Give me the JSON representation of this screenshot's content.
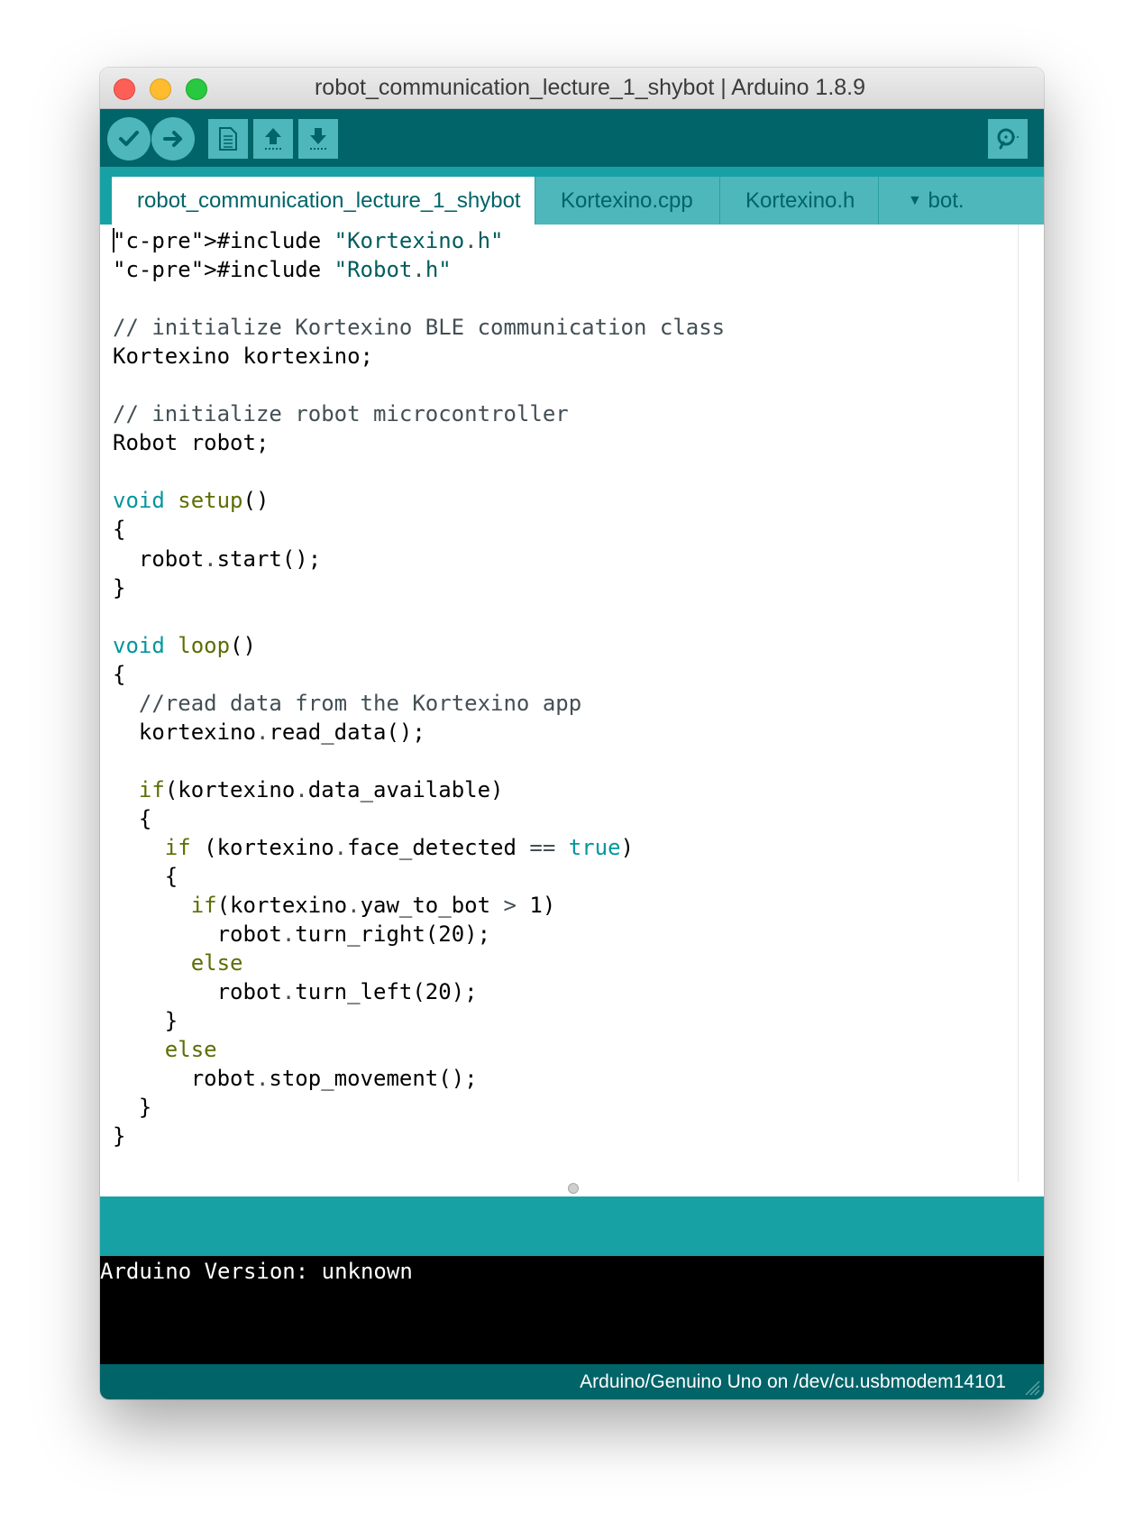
{
  "window": {
    "title": "robot_communication_lecture_1_shybot | Arduino 1.8.9"
  },
  "toolbar": {
    "verify_icon": "checkmark-icon",
    "upload_icon": "arrow-right-icon",
    "new_icon": "document-icon",
    "open_icon": "arrow-up-icon",
    "save_icon": "arrow-down-icon",
    "serial_monitor_icon": "magnifier-icon"
  },
  "tabs": [
    {
      "label": "robot_communication_lecture_1_shybot",
      "active": true
    },
    {
      "label": "Kortexino.cpp",
      "active": false
    },
    {
      "label": "Kortexino.h",
      "active": false
    },
    {
      "label": "bot.",
      "active": false
    }
  ],
  "editor": {
    "lines": [
      "#include \"Kortexino.h\"",
      "#include \"Robot.h\"",
      "",
      "// initialize Kortexino BLE communication class",
      "Kortexino kortexino;",
      "",
      "// initialize robot microcontroller",
      "Robot robot;",
      "",
      "void setup()",
      "{",
      "  robot.start();",
      "}",
      "",
      "void loop()",
      "{",
      "  //read data from the Kortexino app",
      "  kortexino.read_data();",
      "",
      "  if(kortexino.data_available)",
      "  {",
      "    if (kortexino.face_detected == true)",
      "    {",
      "      if(kortexino.yaw_to_bot > 1)",
      "        robot.turn_right(20);",
      "      else",
      "        robot.turn_left(20);",
      "    }",
      "    else",
      "      robot.stop_movement();",
      "  }",
      "}"
    ]
  },
  "console": {
    "text": "Arduino Version: unknown"
  },
  "status": {
    "board": "Arduino/Genuino Uno on /dev/cu.usbmodem14101"
  },
  "colors": {
    "toolbar": "#006468",
    "tabbar": "#17a1a5",
    "tab": "#4db7bb",
    "keyword": "#00979c",
    "function": "#5e6d03",
    "string": "#005c5f",
    "comment": "#434f54"
  }
}
